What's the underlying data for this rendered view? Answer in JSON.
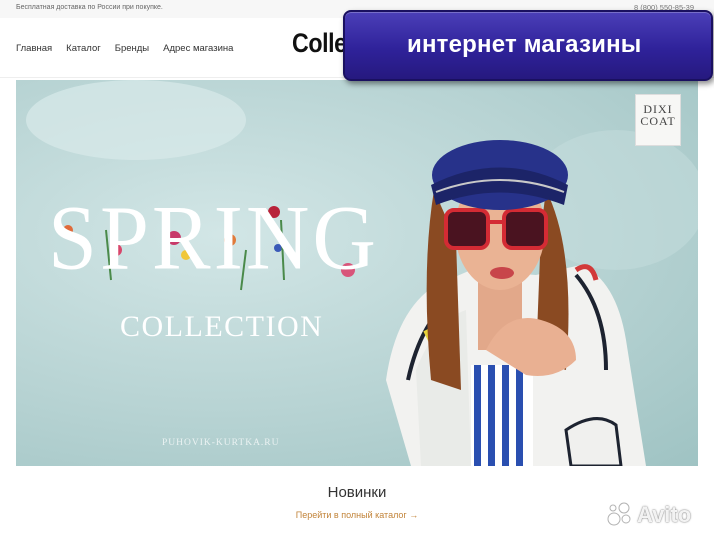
{
  "topbar": {
    "promo": "Бесплатная доставка по России при покупке.",
    "phone": "8 (800) 550-85-39"
  },
  "header": {
    "nav": [
      "Главная",
      "Каталог",
      "Бренды",
      "Адрес магазина"
    ],
    "logo": "Collec"
  },
  "overlay": {
    "text": "интернет магазины",
    "color": "#2f229a"
  },
  "hero": {
    "headline": "SPRING",
    "subheadline": "COLLECTION",
    "site": "PUHOVIK-KURTKA.RU",
    "brand_line1": "DIXI",
    "brand_line2": "COAT",
    "background": "#b7d3d3"
  },
  "section": {
    "title": "Новинки",
    "link": "Перейти в полный каталог →",
    "link_color": "#c2843a"
  },
  "watermark": {
    "text": "Avito"
  }
}
